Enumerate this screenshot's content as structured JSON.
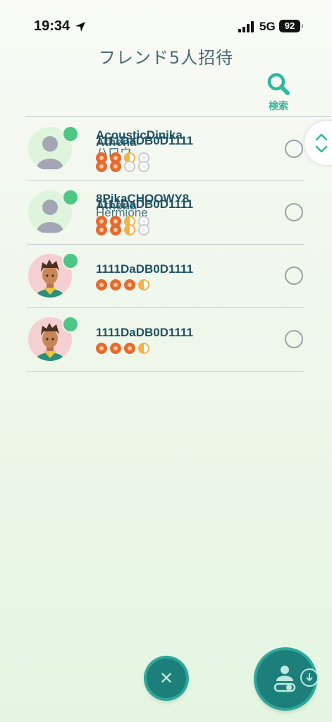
{
  "status_bar": {
    "time": "19:34",
    "network": "5G",
    "battery": "92"
  },
  "header": {
    "title": "フレンド5人招待",
    "search_label": "検索"
  },
  "friends": [
    {
      "name_layers": [
        "AcousticDinika",
        "Athena",
        "1111DaDB0D1111",
        "ハロウ"
      ],
      "hearts": [
        "full",
        "full",
        "half",
        "empty"
      ],
      "hearts_second": [
        "full",
        "full",
        "empty",
        "empty"
      ],
      "avatar": "default",
      "online": true
    },
    {
      "name_layers": [
        "8PikaCHOOWY8",
        "Athena",
        "1111DaDB0D1111",
        "Hermione"
      ],
      "hearts": [
        "full",
        "full",
        "half",
        "empty"
      ],
      "hearts_second": [
        "full",
        "full",
        "half",
        "empty"
      ],
      "avatar": "default",
      "online": true
    },
    {
      "name": "1111DaDB0D1111",
      "hearts": [
        "full",
        "full",
        "full",
        "half"
      ],
      "avatar": "trainer",
      "online": true
    },
    {
      "name": "1111DaDB0D1111",
      "hearts": [
        "full",
        "full",
        "full",
        "half"
      ],
      "avatar": "trainer",
      "online": true
    }
  ],
  "icons": {
    "search": "search-icon",
    "close": "close-icon",
    "scroll": "chevron-up-down-icon",
    "party": "party-icon"
  },
  "colors": {
    "accent": "#2fb89c",
    "button": "#1c7f79",
    "online": "#4fc586",
    "heart": "#e56a2f"
  }
}
